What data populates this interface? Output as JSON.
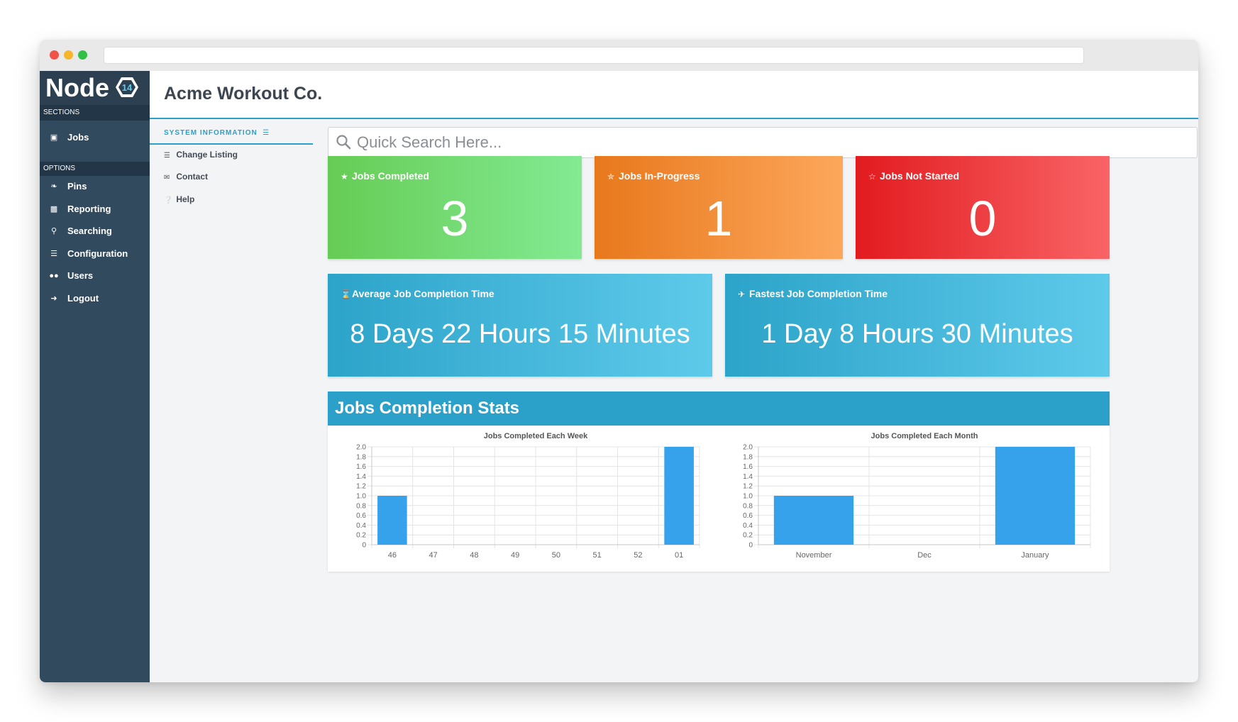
{
  "colors": {
    "sidebar": "#324a5e",
    "accent": "#2ba0c8",
    "bar": "#36a2eb"
  },
  "brand": {
    "name": "Node",
    "badge": "14"
  },
  "sidebar": {
    "sections_heading": "SECTIONS",
    "options_heading": "OPTIONS",
    "section_items": [
      {
        "label": "Jobs",
        "icon": "inbox-icon"
      }
    ],
    "option_items": [
      {
        "label": "Pins",
        "icon": "pushpin-icon"
      },
      {
        "label": "Reporting",
        "icon": "file-icon"
      },
      {
        "label": "Searching",
        "icon": "search-icon"
      },
      {
        "label": "Configuration",
        "icon": "sliders-icon"
      },
      {
        "label": "Users",
        "icon": "users-icon"
      },
      {
        "label": "Logout",
        "icon": "logout-icon"
      }
    ]
  },
  "header": {
    "title": "Acme Workout Co."
  },
  "subnav": {
    "heading": "SYSTEM INFORMATION",
    "items": [
      {
        "label": "Change Listing",
        "icon": "list-icon"
      },
      {
        "label": "Contact",
        "icon": "envelope-icon"
      },
      {
        "label": "Help",
        "icon": "question-icon"
      }
    ]
  },
  "search": {
    "placeholder": "Quick Search Here...",
    "value": ""
  },
  "stat_cards": [
    {
      "label": "Jobs Completed",
      "value": "3",
      "icon": "star-icon",
      "color": "#66cc55"
    },
    {
      "label": "Jobs In-Progress",
      "value": "1",
      "icon": "half-star-icon",
      "color": "#e8781c"
    },
    {
      "label": "Jobs Not Started",
      "value": "0",
      "icon": "star-outline-icon",
      "color": "#e21b1f"
    }
  ],
  "time_cards": [
    {
      "label": "Average Job Completion Time",
      "value": "8 Days 22 Hours 15 Minutes",
      "icon": "hourglass-icon"
    },
    {
      "label": "Fastest Job Completion Time",
      "value": "1 Day 8 Hours 30 Minutes",
      "icon": "plane-icon"
    }
  ],
  "stats_panel": {
    "title": "Jobs Completion Stats"
  },
  "chart_data": [
    {
      "type": "bar",
      "title": "Jobs Completed Each Week",
      "categories": [
        "46",
        "47",
        "48",
        "49",
        "50",
        "51",
        "52",
        "01"
      ],
      "values": [
        1,
        0,
        0,
        0,
        0,
        0,
        0,
        2
      ],
      "ylim": [
        0,
        2.0
      ],
      "yticks": [
        "0",
        "0.2",
        "0.4",
        "0.6",
        "0.8",
        "1.0",
        "1.2",
        "1.4",
        "1.6",
        "1.8",
        "2.0"
      ],
      "grid": true,
      "legend": "none"
    },
    {
      "type": "bar",
      "title": "Jobs Completed Each Month",
      "categories": [
        "November",
        "Dec",
        "January"
      ],
      "values": [
        1,
        0,
        2
      ],
      "ylim": [
        0,
        2.0
      ],
      "yticks": [
        "0",
        "0.2",
        "0.4",
        "0.6",
        "0.8",
        "1.0",
        "1.2",
        "1.4",
        "1.6",
        "1.8",
        "2.0"
      ],
      "grid": true,
      "legend": "none"
    }
  ]
}
